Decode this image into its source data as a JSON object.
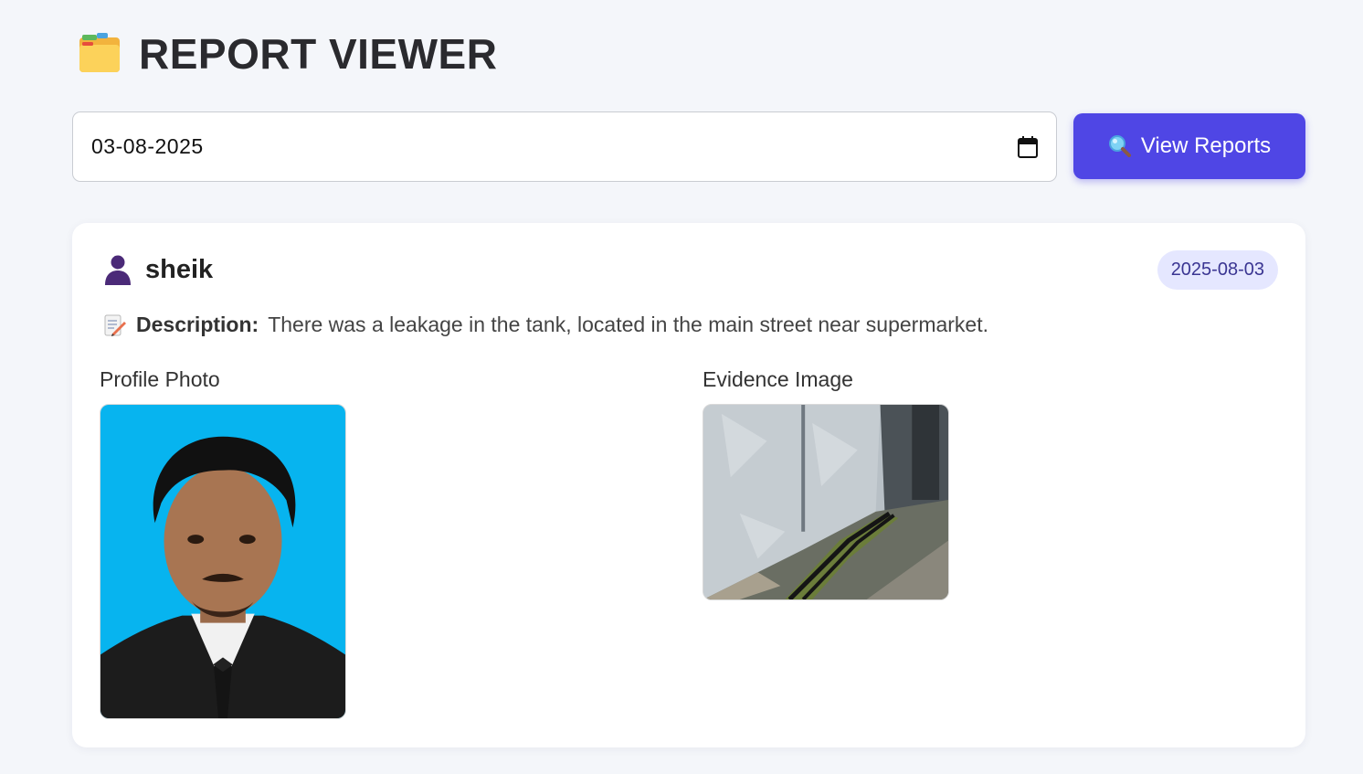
{
  "header": {
    "title": "REPORT VIEWER",
    "icon": "folder-icon"
  },
  "controls": {
    "date_value": "03-08-2025",
    "date_icon": "calendar-icon",
    "view_button_label": "View Reports",
    "view_button_icon": "magnifier-icon",
    "button_color": "#4f46e5"
  },
  "report": {
    "user_icon": "user-icon",
    "user_name": "sheik",
    "date_badge": "2025-08-03",
    "description_icon": "memo-icon",
    "description_label": "Description:",
    "description_text": "There was a leakage in the tank, located in the main street near supermarket.",
    "profile_label": "Profile Photo",
    "evidence_label": "Evidence Image"
  }
}
